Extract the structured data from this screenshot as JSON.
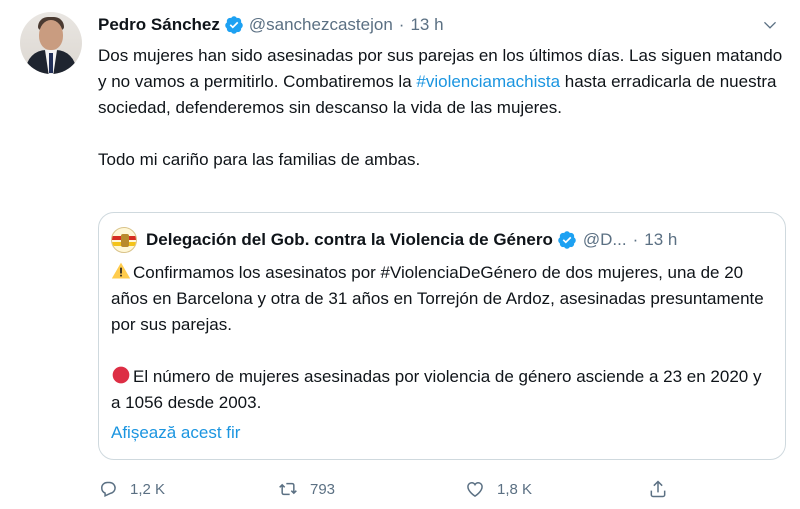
{
  "author": {
    "display_name": "Pedro Sánchez",
    "handle": "@sanchezcastejon",
    "separator": "·",
    "time": "13 h"
  },
  "tweet": {
    "para1_a": "Dos mujeres han sido asesinadas por sus parejas en los últimos días. Las siguen matando y no vamos a permitirlo. Combatiremos la ",
    "hashtag": "#violenciamachista",
    "para1_b": " hasta erradicarla de nuestra sociedad, defenderemos sin descanso la vida de las mujeres.",
    "para2": "Todo mi cariño para las familias de ambas."
  },
  "quote": {
    "display_name": "Delegación del Gob. contra la Violencia de Género",
    "handle": "@D...",
    "separator": "·",
    "time": "13 h",
    "para1": "Confirmamos los asesinatos por #ViolenciaDeGénero de dos mujeres, una de 20 años en Barcelona y otra de 31 años en Torrejón de Ardoz, asesinadas presuntamente por sus parejas.",
    "para2": "El número de mujeres asesinadas por violencia de género asciende a 23 en 2020 y a 1056 desde 2003.",
    "show_thread": "Afișează acest fir"
  },
  "actions": {
    "replies": "1,2 K",
    "retweets": "793",
    "likes": "1,8 K"
  },
  "icons": {
    "verified": "verified-badge-icon",
    "more": "chevron-down-icon",
    "reply": "reply-icon",
    "retweet": "retweet-icon",
    "like": "heart-icon",
    "share": "share-icon",
    "warning": "warning-emoji-icon",
    "red_circle": "red-circle-emoji-icon"
  },
  "colors": {
    "link": "#1b95e0",
    "verified": "#1da1f2",
    "secondary_text": "#5b7083",
    "border": "#cfd9de"
  }
}
